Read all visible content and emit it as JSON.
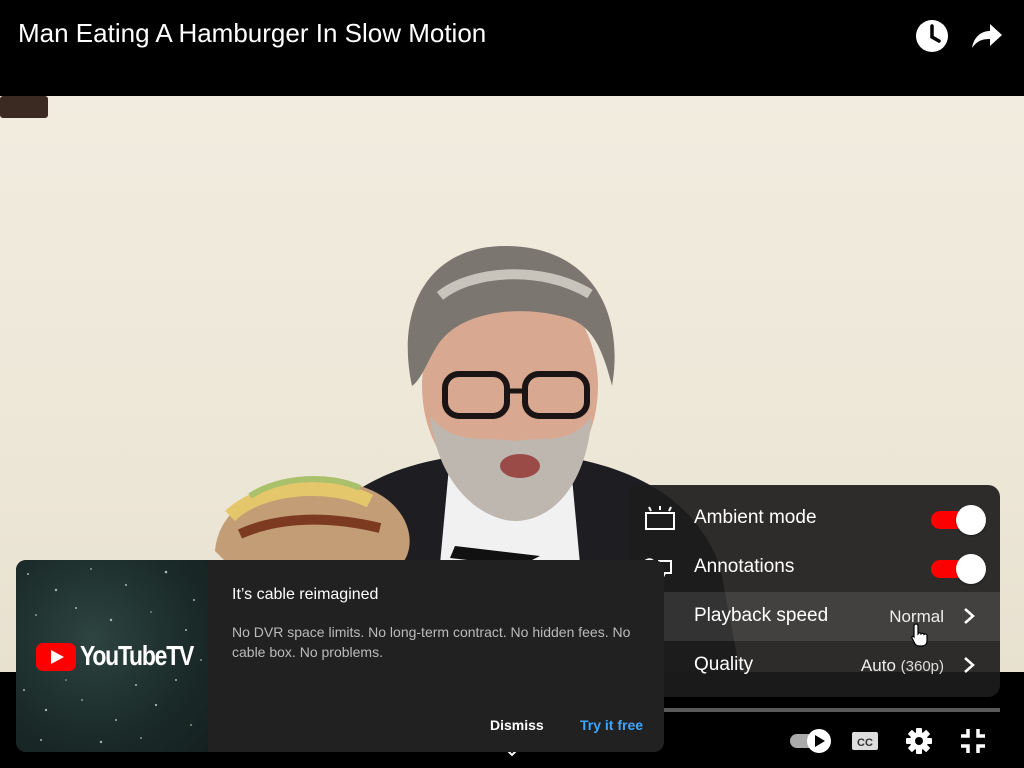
{
  "header": {
    "title": "Man Eating A Hamburger In Slow Motion",
    "watch_later_icon": "clock-icon",
    "share_icon": "share-arrow-icon"
  },
  "settings_menu": {
    "items": [
      {
        "label": "Ambient mode",
        "icon": "ambient-mode-icon",
        "toggle": true,
        "on": true
      },
      {
        "label": "Annotations",
        "icon": "annotations-icon",
        "toggle": true,
        "on": true
      },
      {
        "label": "Playback speed",
        "icon": "playback-speed-icon",
        "value": "Normal",
        "highlighted": true
      },
      {
        "label": "Quality",
        "icon": "quality-icon",
        "value": "Auto",
        "value_detail": "(360p)"
      }
    ],
    "toggle_color": "#ff0000"
  },
  "promo": {
    "logo_text": "YouTubeTV",
    "title": "It’s cable reimagined",
    "body": "No DVR space limits. No long-term contract. No hidden fees. No cable box. No problems.",
    "dismiss_label": "Dismiss",
    "try_label": "Try it free",
    "accent": "#3ea6ff"
  },
  "controls": {
    "icons": [
      "autoplay-toggle-icon",
      "closed-captions-icon",
      "settings-gear-icon",
      "exit-fullscreen-icon",
      "chevron-down-icon"
    ]
  }
}
